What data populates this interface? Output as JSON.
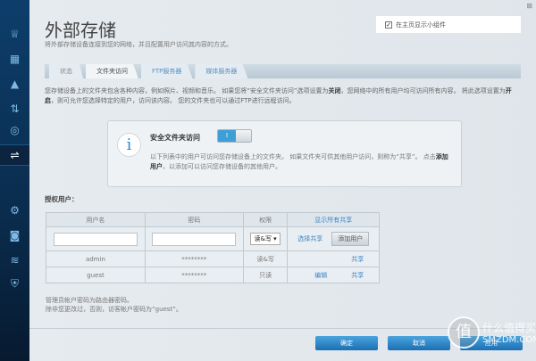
{
  "sidebar": {
    "items": [
      {
        "name": "router-icon",
        "glyph": "♕"
      },
      {
        "name": "devices-icon",
        "glyph": "▦"
      },
      {
        "name": "warning-icon",
        "glyph": "▲"
      },
      {
        "name": "media-icon",
        "glyph": "⇅"
      },
      {
        "name": "speed-icon",
        "glyph": "◎"
      },
      {
        "name": "usb-icon",
        "glyph": "⇌"
      },
      {
        "name": "settings-icon",
        "glyph": "⚙"
      },
      {
        "name": "camera-icon",
        "glyph": "◙"
      },
      {
        "name": "wifi-icon",
        "glyph": "≋"
      },
      {
        "name": "security-icon",
        "glyph": "⛨"
      }
    ]
  },
  "header": {
    "title": "外部存储",
    "subtitle": "将外部存储设备连接到您的网络，并且配置用户访问其内容的方式。",
    "widget_label": "在主页显示小组件",
    "widget_checked": true,
    "close": "⊠"
  },
  "tabs": [
    {
      "label": "状态"
    },
    {
      "label": "文件夹访问"
    },
    {
      "label": "FTP服务器"
    },
    {
      "label": "媒体服务器"
    }
  ],
  "intro": {
    "part1": "您存储设备上的文件夹包含各种内容，例如照片、视频和音乐。 如果您将“安全文件夹访问”选项设置为",
    "off": "关闭",
    "part2": "，您网络中的所有用户均可访问所有内容。 将此选项设置为",
    "on": "开启",
    "part3": "，则可允许您选择特定的用户，访问该内容。 您的文件夹也可以通过FTP进行远程访问。"
  },
  "info": {
    "icon": "i",
    "title": "安全文件夹访问",
    "toggle_label": "I",
    "text1": "以下列表中的用户可访问您存储设备上的文件夹。 如果文件夹可供其他用户访问，则称为“共享”。 点击",
    "add_user": "添加用户",
    "text2": "，以添加可以访问您存储设备的其他用户。"
  },
  "users": {
    "label": "授权用户：",
    "headers": [
      "用户名",
      "密码",
      "权限",
      "显示所有共享"
    ],
    "new_row": {
      "permission": "读&写 ▾",
      "select_share": "选择共享",
      "add_button": "添加用户"
    },
    "rows": [
      {
        "username": "admin",
        "password": "********",
        "permission": "读&写",
        "edit": "",
        "share": "共享"
      },
      {
        "username": "guest",
        "password": "********",
        "permission": "只读",
        "edit": "编辑",
        "share": "共享"
      }
    ]
  },
  "notes": [
    "管理员帐户密码为路由器密码。",
    "除非您更改过，否则，访客帐户密码为“guest”。"
  ],
  "footer": {
    "ok": "确定",
    "cancel": "取消",
    "apply": "应用"
  },
  "watermark": {
    "logo": "值",
    "text": "什么值得买",
    "url": "SMZDM.COM"
  }
}
